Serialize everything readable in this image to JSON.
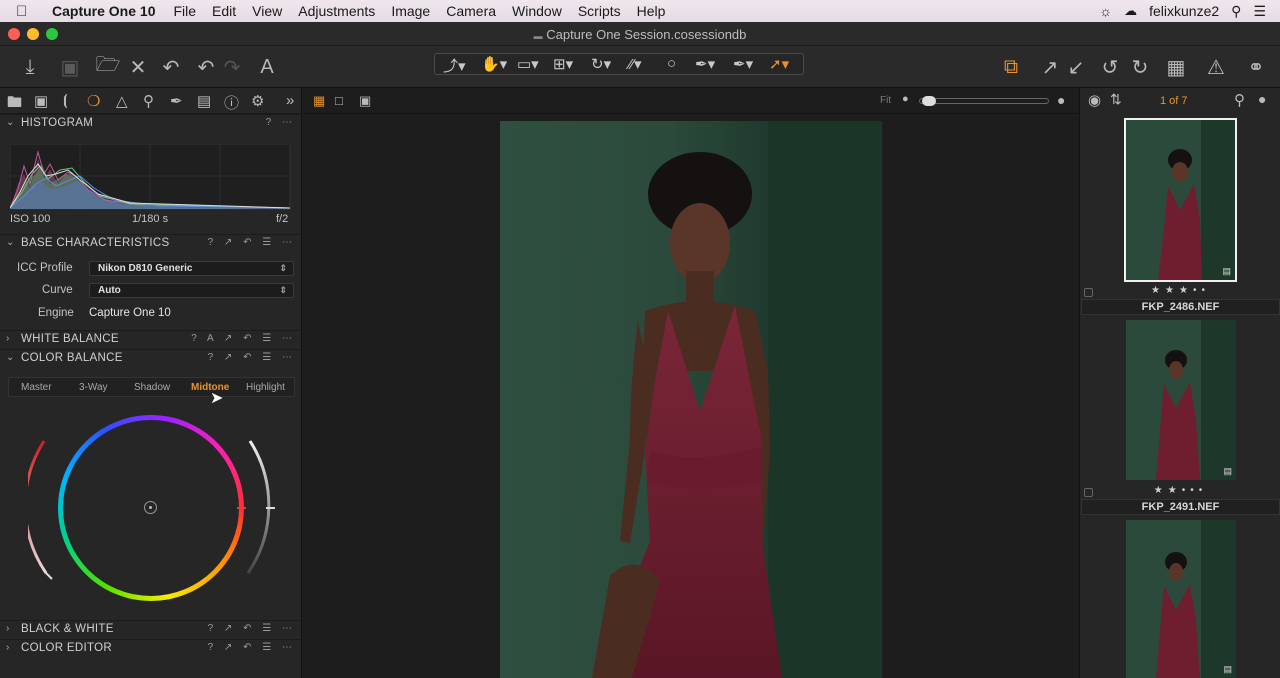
{
  "menubar": {
    "app": "Capture One 10",
    "items": [
      "File",
      "Edit",
      "View",
      "Adjustments",
      "Image",
      "Camera",
      "Window",
      "Scripts",
      "Help"
    ],
    "user": "felixkunze2"
  },
  "window": {
    "title": "Capture One Session.cosessiondb"
  },
  "histogram": {
    "title": "HISTOGRAM",
    "iso": "ISO 100",
    "shutter": "1/180 s",
    "aperture": "f/2"
  },
  "base": {
    "title": "BASE CHARACTERISTICS",
    "icc_label": "ICC Profile",
    "icc_value": "Nikon D810 Generic",
    "curve_label": "Curve",
    "curve_value": "Auto",
    "engine_label": "Engine",
    "engine_value": "Capture One 10"
  },
  "white_balance": {
    "title": "WHITE BALANCE"
  },
  "color_balance": {
    "title": "COLOR BALANCE",
    "tabs": [
      "Master",
      "3-Way",
      "Shadow",
      "Midtone",
      "Highlight"
    ],
    "active_tab": "Midtone"
  },
  "black_white": {
    "title": "BLACK & WHITE"
  },
  "color_editor": {
    "title": "COLOR EDITOR"
  },
  "viewer": {
    "fit_label": "Fit"
  },
  "browser": {
    "counter": "1 of 7",
    "thumbs": [
      {
        "name": "FKP_2486.NEF",
        "stars": 3
      },
      {
        "name": "FKP_2491.NEF",
        "stars": 2
      }
    ]
  },
  "colors": {
    "accent": "#e8932e",
    "panel": "#262626",
    "photo_bg": "#2b4a3a",
    "dress": "#6e1e2e"
  }
}
